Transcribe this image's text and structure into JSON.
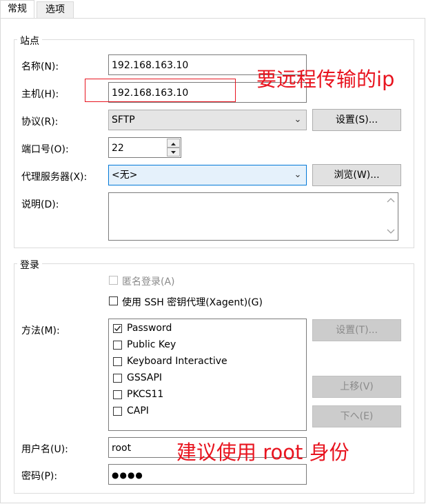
{
  "tabs": [
    {
      "label": "常规",
      "active": true
    },
    {
      "label": "选项",
      "active": false
    }
  ],
  "site": {
    "group_title": "站点",
    "name_label": "名称(N):",
    "name_value": "192.168.163.10",
    "host_label": "主机(H):",
    "host_value": "192.168.163.10",
    "protocol_label": "协议(R):",
    "protocol_value": "SFTP",
    "protocol_settings_button": "设置(S)...",
    "port_label": "端口号(O):",
    "port_value": "22",
    "proxy_label": "代理服务器(X):",
    "proxy_value": "<无>",
    "proxy_browse_button": "浏览(W)...",
    "description_label": "说明(D):",
    "description_value": ""
  },
  "login": {
    "group_title": "登录",
    "anonymous_label": "匿名登录(A)",
    "anonymous_checked": false,
    "anonymous_disabled": true,
    "ssh_agent_label": "使用 SSH 密钥代理(Xagent)(G)",
    "ssh_agent_checked": false,
    "method_label": "方法(M):",
    "methods": [
      {
        "label": "Password",
        "checked": true
      },
      {
        "label": "Public Key",
        "checked": false
      },
      {
        "label": "Keyboard Interactive",
        "checked": false
      },
      {
        "label": "GSSAPI",
        "checked": false
      },
      {
        "label": "PKCS11",
        "checked": false
      },
      {
        "label": "CAPI",
        "checked": false
      }
    ],
    "method_settings_button": "设置(T)...",
    "move_up_button": "上移(V)",
    "move_down_button": "下へ(E)",
    "username_label": "用户名(U):",
    "username_value": "root",
    "password_label": "密码(P):",
    "password_value": "●●●●"
  },
  "annotations": {
    "host_note": "要远程传输的ip",
    "user_note": "建议使用 root 身份",
    "color": "#e8141f"
  }
}
